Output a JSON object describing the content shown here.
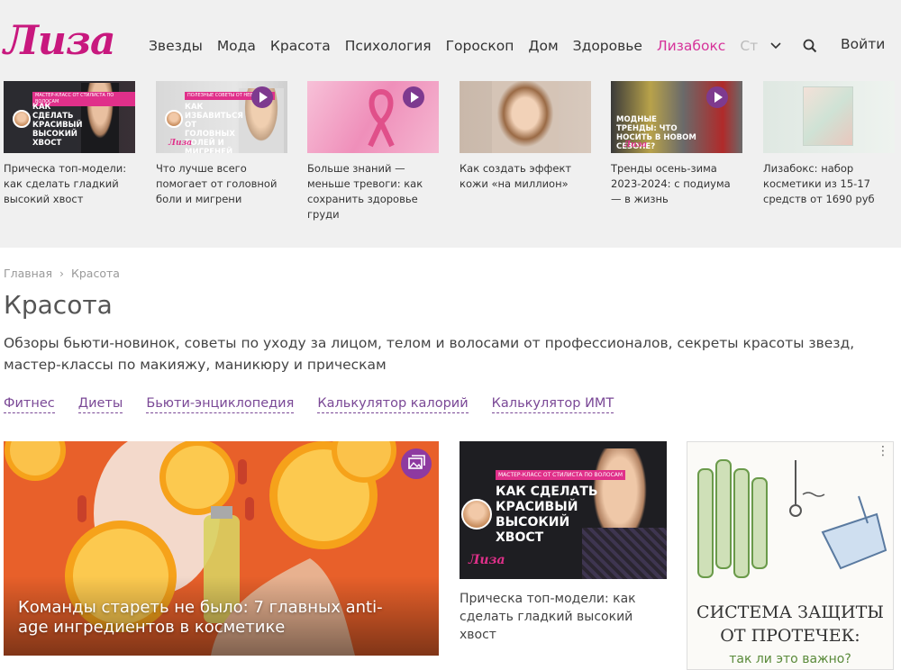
{
  "header": {
    "logo": "Лиза",
    "nav": [
      "Звезды",
      "Мода",
      "Красота",
      "Психология",
      "Гороскоп",
      "Дом",
      "Здоровье"
    ],
    "nav_highlight": "Лизабокс",
    "nav_more": "Ст",
    "login": "Войти"
  },
  "top_cards": [
    {
      "caption": "Прическа топ-модели: как сделать гладкий высокий хвост",
      "tag": "МАСТЕР-КЛАСС ОТ СТИЛИСТА ПО ВОЛОСАМ",
      "thumb_title": "КАК СДЕЛАТЬ КРАСИВЫЙ ВЫСОКИЙ ХВОСТ"
    },
    {
      "caption": "Что лучше всего помогает от головной боли и мигрени",
      "tag": "ПОЛЕЗНЫЕ СОВЕТЫ ОТ НЕВРОЛОГА",
      "thumb_title": "КАК ИЗБАВИТЬСЯ ОТ ГОЛОВНЫХ БОЛЕЙ И МИГРЕНЕЙ",
      "logo": "Лиза"
    },
    {
      "caption": "Больше знаний — меньше тревоги: как сохранить здоровье груди"
    },
    {
      "caption": "Как создать эффект кожи «на миллион»"
    },
    {
      "caption": "Тренды осень-зима 2023-2024: с подиума — в жизнь",
      "thumb_title": "МОДНЫЕ ТРЕНДЫ: ЧТО НОСИТЬ В НОВОМ СЕЗОНЕ?",
      "logo": "Лиза"
    },
    {
      "caption": "Лизабокс: набор косметики из 15-17 средств от 1690 руб"
    }
  ],
  "breadcrumbs": {
    "home": "Главная",
    "sep": "›",
    "current": "Красота"
  },
  "page": {
    "title": "Красота",
    "description": "Обзоры бьюти-новинок, советы по уходу за лицом, телом и волосами от профессионалов, секреты красоты звезд, мастер-классы по макияжу, маникюру и прическам"
  },
  "chips": [
    "Фитнес",
    "Диеты",
    "Бьюти-энциклопедия",
    "Калькулятор калорий",
    "Калькулятор ИМТ"
  ],
  "feature": {
    "title": "Команды стареть не было: 7 главных anti-age ингредиентов в косметике"
  },
  "mid_card": {
    "tag": "МАСТЕР-КЛАСС ОТ СТИЛИСТА ПО ВОЛОСАМ",
    "thumb_title": "КАК СДЕЛАТЬ КРАСИВЫЙ ВЫСОКИЙ ХВОСТ",
    "logo": "Лиза",
    "caption": "Прическа топ-модели: как сделать гладкий высокий хвост"
  },
  "ad": {
    "line1": "СИСТЕМА ЗАЩИТЫ",
    "line2": "ОТ ПРОТЕЧЕК:",
    "line3": "так ли это важно?",
    "menu": "⋮"
  },
  "colors": {
    "brand": "#c8187e",
    "accent": "#d6339a",
    "chip": "#7a4896",
    "top_bg": "#f0f0f0"
  }
}
